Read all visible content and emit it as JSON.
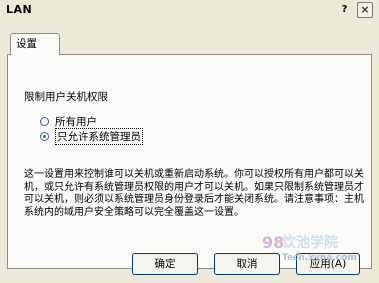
{
  "window": {
    "title": "LAN",
    "help_glyph": "?",
    "close_glyph": "×"
  },
  "tabs": [
    {
      "label": "设置"
    }
  ],
  "section": {
    "title": "限制用户关机权限"
  },
  "options": [
    {
      "label": "所有用户",
      "checked": false
    },
    {
      "label": "只允许系统管理员",
      "checked": true
    }
  ],
  "description": "这一设置用来控制谁可以关机或重新启动系统。你可以授权所有用户都可以关机，或只允许有系统管理员权限的用户才可以关机。如果只限制系统管理员才可以关机，则必须以系统管理员身份登录后才能关闭系统。请注意事项：主机系统内的域用户安全策略可以完全覆盖这一设置。",
  "buttons": {
    "ok": "确定",
    "cancel": "取消",
    "apply": "应用(A)"
  },
  "watermark": {
    "logo": "98",
    "text": "饮池学院",
    "url": "Tech.xvna.com"
  }
}
